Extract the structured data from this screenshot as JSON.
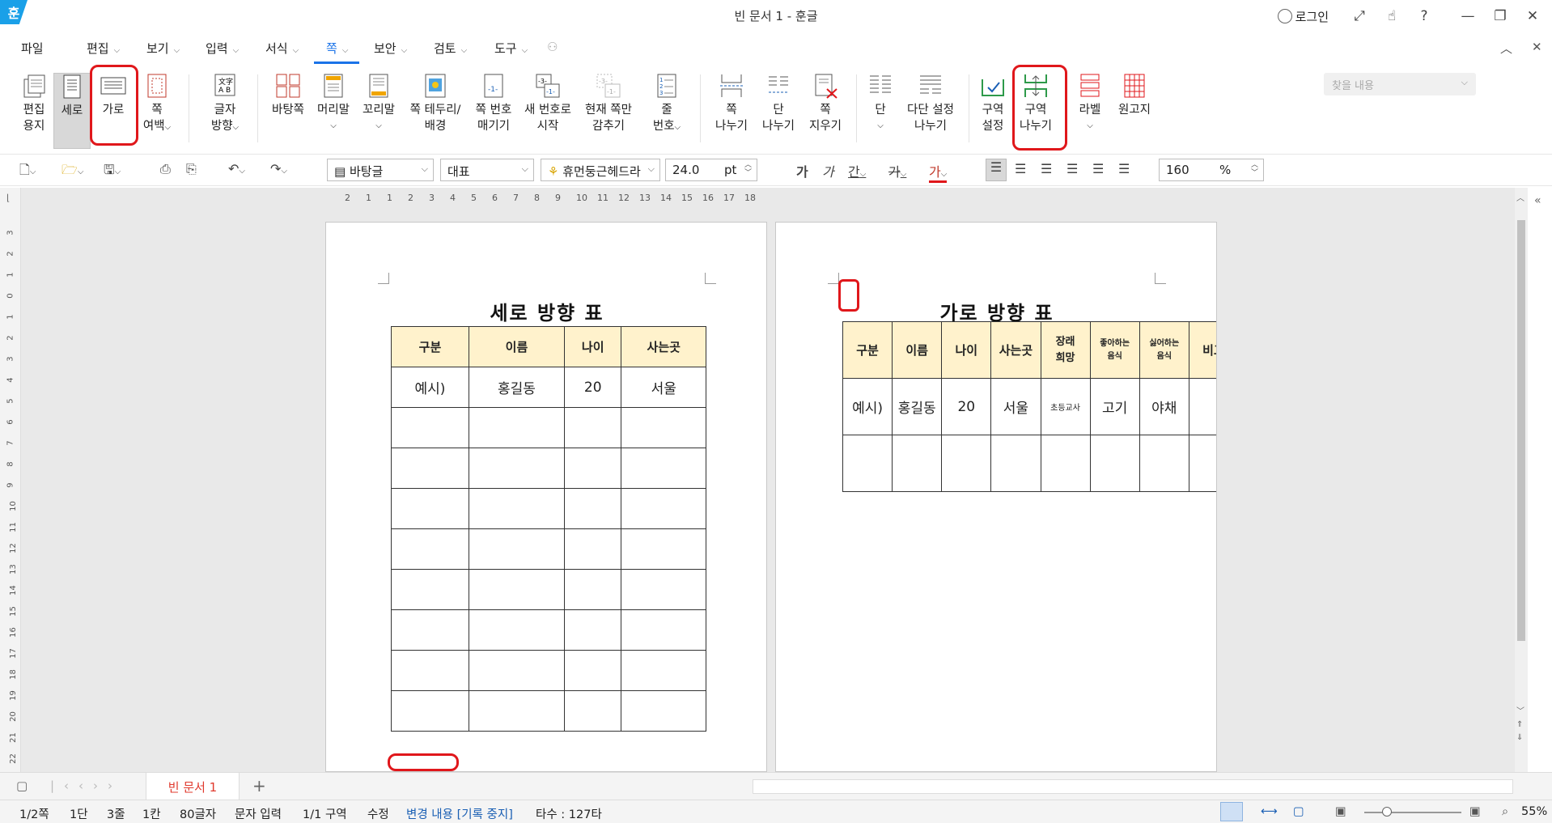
{
  "window": {
    "app_icon": "훈",
    "title": "빈 문서 1 - 훈글",
    "login": "로그인"
  },
  "menu": [
    "파일",
    "편집",
    "보기",
    "입력",
    "서식",
    "쪽",
    "보안",
    "검토",
    "도구"
  ],
  "search": {
    "placeholder": "찾을 내용"
  },
  "ribbon": [
    {
      "l1": "편집",
      "l2": "용지"
    },
    {
      "l1": "세로",
      "l2": ""
    },
    {
      "l1": "가로",
      "l2": ""
    },
    {
      "l1": "쪽",
      "l2": "여백"
    },
    {
      "l1": "글자",
      "l2": "방향"
    },
    {
      "l1": "바탕쪽",
      "l2": ""
    },
    {
      "l1": "머리말",
      "l2": ""
    },
    {
      "l1": "꼬리말",
      "l2": ""
    },
    {
      "l1": "쪽 테두리/",
      "l2": "배경"
    },
    {
      "l1": "쪽 번호",
      "l2": "매기기"
    },
    {
      "l1": "새 번호로",
      "l2": "시작"
    },
    {
      "l1": "현재 쪽만",
      "l2": "감추기"
    },
    {
      "l1": "줄",
      "l2": "번호"
    },
    {
      "l1": "쪽",
      "l2": "나누기"
    },
    {
      "l1": "단",
      "l2": "나누기"
    },
    {
      "l1": "쪽",
      "l2": "지우기"
    },
    {
      "l1": "단",
      "l2": ""
    },
    {
      "l1": "다단 설정",
      "l2": "나누기"
    },
    {
      "l1": "구역",
      "l2": "설정"
    },
    {
      "l1": "구역",
      "l2": "나누기"
    },
    {
      "l1": "라벨",
      "l2": ""
    },
    {
      "l1": "원고지",
      "l2": ""
    }
  ],
  "format": {
    "style": "바탕글",
    "fontset": "대표",
    "font": "휴먼둥근헤드라",
    "size": "24.0",
    "unit": "pt",
    "b": "가",
    "i": "가",
    "u": "간",
    "s": "가",
    "zoom": "160",
    "pct": "%"
  },
  "ruler_ticks": [
    "2",
    "1",
    "1",
    "2",
    "3",
    "4",
    "5",
    "6",
    "7",
    "8",
    "9",
    "10",
    "11",
    "12",
    "13",
    "14",
    "15",
    "16",
    "17",
    "18"
  ],
  "vruler_ticks": [
    "3",
    "2",
    "1",
    "0",
    "1",
    "2",
    "3",
    "4",
    "5",
    "6",
    "7",
    "8",
    "9",
    "10",
    "11",
    "12",
    "13",
    "14",
    "15",
    "16",
    "17",
    "18",
    "19",
    "20",
    "21",
    "22"
  ],
  "page1": {
    "title": "세로 방향 표",
    "headers": [
      "구분",
      "이름",
      "나이",
      "사는곳"
    ],
    "row": [
      "예시)",
      "홍길동",
      "20",
      "서울"
    ]
  },
  "page2": {
    "title": "가로 방향 표",
    "headers": [
      "구분",
      "이름",
      "나이",
      "사는곳",
      "장래희망",
      "좋아하는음식",
      "싫어하는음식",
      "비고"
    ],
    "headers_top": [
      "구분",
      "이름",
      "나이",
      "사는곳",
      "장래",
      "좋아하는",
      "싫어하는",
      "비고"
    ],
    "headers_bottom": [
      "",
      "",
      "",
      "",
      "희망",
      "음식",
      "음식",
      ""
    ],
    "row": [
      "예시)",
      "홍길동",
      "20",
      "서울",
      "초등교사",
      "고기",
      "야채",
      ""
    ]
  },
  "tabs": {
    "doc": "빈 문서 1",
    "add": "+"
  },
  "status": {
    "page": "1/2쪽",
    "col": "1단",
    "line": "3줄",
    "cell": "1칸",
    "chars": "80글자",
    "mode": "문자 입력",
    "section": "1/1 구역",
    "edit": "수정",
    "track": "변경 내용 [기록 중지]",
    "strokes": "타수 : 127타",
    "zoom": "55%"
  },
  "colors": {
    "accent": "#1a73e8",
    "highlight": "#e0171b",
    "table_header": "#fff2cc",
    "tab_text": "#e0392d"
  }
}
